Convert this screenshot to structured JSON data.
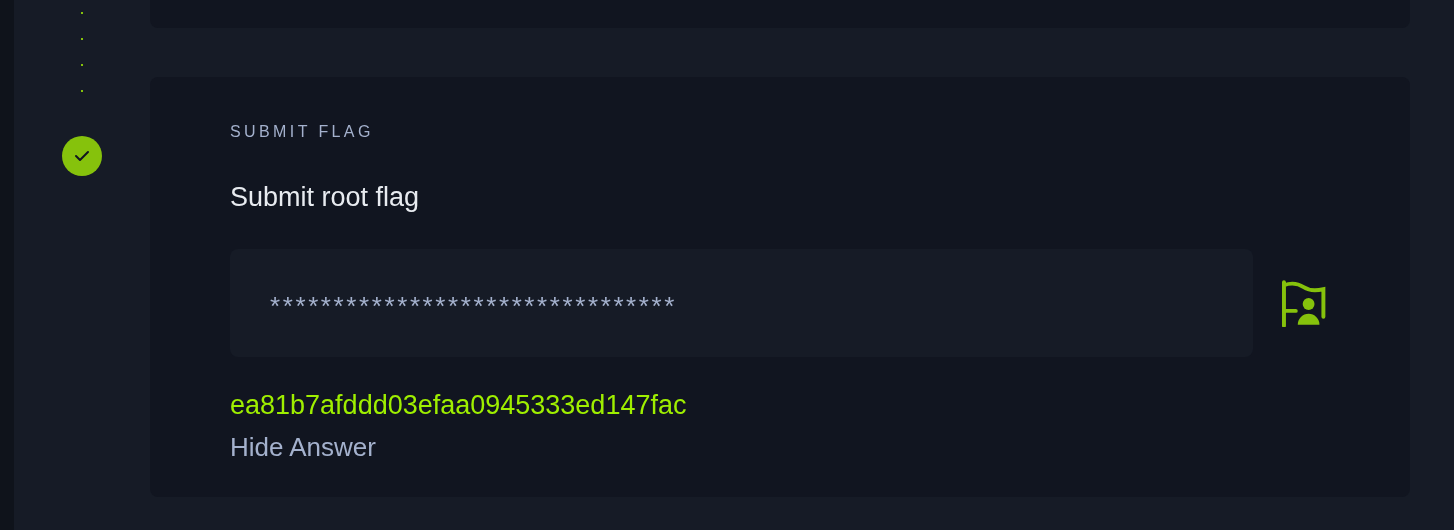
{
  "steps": [
    {
      "completed": true,
      "label": "SUBMIT FLAG",
      "title": "Submit root flag",
      "input_value": "********************************",
      "answer": "ea81b7afddd03efaa0945333ed147fac",
      "toggle": "Hide Answer"
    }
  ]
}
